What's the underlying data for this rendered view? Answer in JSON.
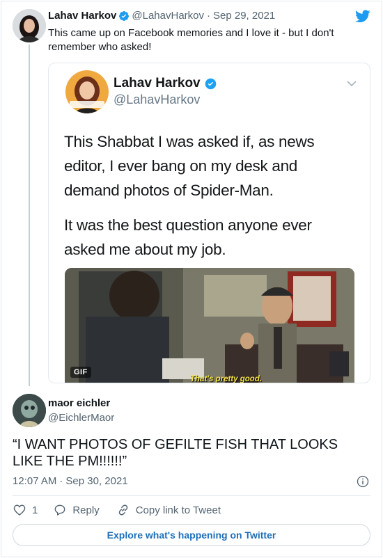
{
  "parent_tweet": {
    "author_name": "Lahav Harkov",
    "author_handle": "@LahavHarkov",
    "separator": "·",
    "date": "Sep 29, 2021",
    "text": "This came up on Facebook memories and I love it - but I don't remember who asked!"
  },
  "quoted_screenshot": {
    "author_name": "Lahav Harkov",
    "author_handle": "@LahavHarkov",
    "body_paragraph_1": "This Shabbat I was asked if, as news editor, I ever bang on my desk and demand photos of Spider-Man.",
    "body_paragraph_2": "It was the best question anyone ever asked me about my job.",
    "media_badge": "GIF",
    "media_subtitle": "That's pretty good."
  },
  "reply_tweet": {
    "author_name": "maor eichler",
    "author_handle": "@EichlerMaor",
    "text": "“I WANT PHOTOS OF GEFILTE FISH THAT LOOKS LIKE THE PM!!!!!!”",
    "time": "12:07 AM",
    "separator": "·",
    "date": "Sep 30, 2021"
  },
  "actions": {
    "like_count": "1",
    "reply_label": "Reply",
    "copy_link_label": "Copy link to Tweet"
  },
  "footer": {
    "explore_label": "Explore what's happening on Twitter"
  },
  "colors": {
    "twitter_blue": "#1d9bf0",
    "link_blue": "#1d6fb8",
    "secondary_text": "#536471"
  },
  "icons": {
    "brand": "twitter-bird-icon",
    "verified": "verified-badge-icon",
    "like": "heart-icon",
    "reply": "speech-bubble-icon",
    "copy_link": "link-icon",
    "info": "info-icon",
    "menu": "chevron-down-icon"
  }
}
